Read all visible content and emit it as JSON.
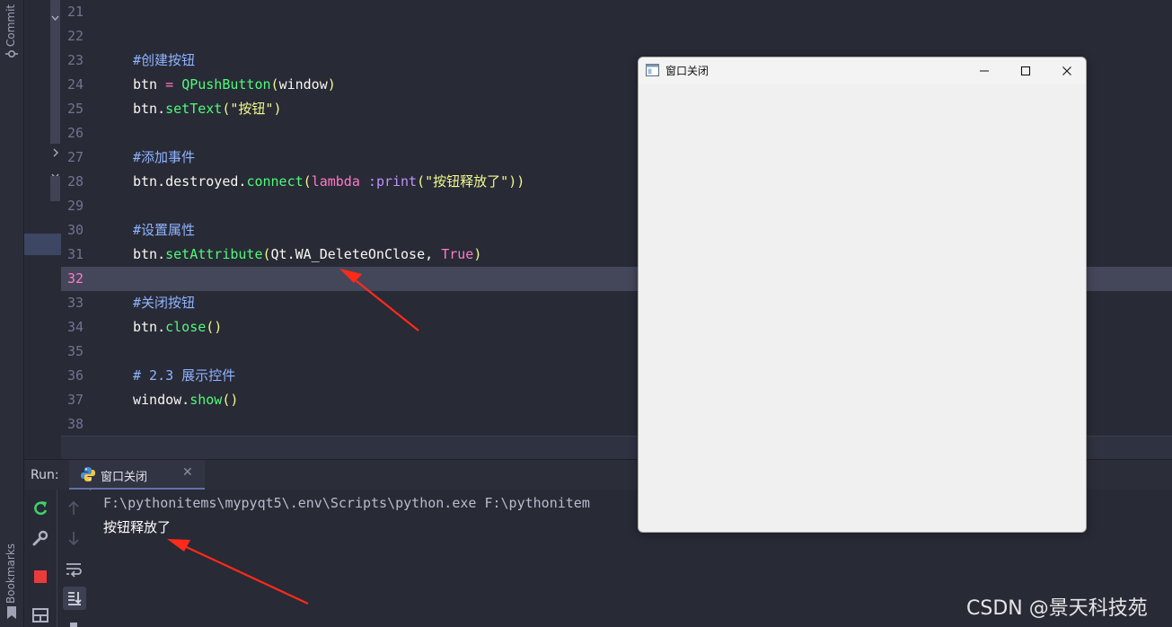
{
  "side_tool_windows": {
    "commit_label": "Commit",
    "bookmarks_label": "Bookmarks"
  },
  "editor": {
    "current_line": "32",
    "lines": [
      {
        "num": "21",
        "tokens": []
      },
      {
        "num": "22",
        "tokens": []
      },
      {
        "num": "23",
        "tokens": [
          {
            "t": "#创建按钮",
            "c": "cmt"
          }
        ]
      },
      {
        "num": "24",
        "tokens": [
          {
            "t": "btn ",
            "c": "var"
          },
          {
            "t": "=",
            "c": "op"
          },
          {
            "t": " ",
            "c": "var"
          },
          {
            "t": "QPushButton",
            "c": "fn"
          },
          {
            "t": "(",
            "c": "par"
          },
          {
            "t": "window",
            "c": "var"
          },
          {
            "t": ")",
            "c": "par"
          }
        ]
      },
      {
        "num": "25",
        "tokens": [
          {
            "t": "btn.",
            "c": "var"
          },
          {
            "t": "setText",
            "c": "fn"
          },
          {
            "t": "(",
            "c": "par"
          },
          {
            "t": "\"按钮\"",
            "c": "str"
          },
          {
            "t": ")",
            "c": "par"
          }
        ]
      },
      {
        "num": "26",
        "tokens": []
      },
      {
        "num": "27",
        "tokens": [
          {
            "t": "#添加事件",
            "c": "cmt"
          }
        ]
      },
      {
        "num": "28",
        "tokens": [
          {
            "t": "btn.destroyed.",
            "c": "var"
          },
          {
            "t": "connect",
            "c": "fn"
          },
          {
            "t": "(",
            "c": "par"
          },
          {
            "t": "lambda",
            "c": "kw"
          },
          {
            "t": " :",
            "c": "kwa"
          },
          {
            "t": "print",
            "c": "kwa"
          },
          {
            "t": "(",
            "c": "par"
          },
          {
            "t": "\"按钮释放了\"",
            "c": "str"
          },
          {
            "t": "))",
            "c": "par"
          }
        ]
      },
      {
        "num": "29",
        "tokens": []
      },
      {
        "num": "30",
        "tokens": [
          {
            "t": "#设置属性",
            "c": "cmt"
          }
        ]
      },
      {
        "num": "31",
        "tokens": [
          {
            "t": "btn.",
            "c": "var"
          },
          {
            "t": "setAttribute",
            "c": "fn"
          },
          {
            "t": "(",
            "c": "par"
          },
          {
            "t": "Qt.WA_DeleteOnClose, ",
            "c": "var"
          },
          {
            "t": "True",
            "c": "kw"
          },
          {
            "t": ")",
            "c": "par"
          }
        ]
      },
      {
        "num": "32",
        "tokens": []
      },
      {
        "num": "33",
        "tokens": [
          {
            "t": "#关闭按钮",
            "c": "cmt"
          }
        ]
      },
      {
        "num": "34",
        "tokens": [
          {
            "t": "btn.",
            "c": "var"
          },
          {
            "t": "close",
            "c": "fn"
          },
          {
            "t": "()",
            "c": "par"
          }
        ]
      },
      {
        "num": "35",
        "tokens": []
      },
      {
        "num": "36",
        "tokens": [
          {
            "t": "# 2.3 展示控件",
            "c": "cmt"
          }
        ]
      },
      {
        "num": "37",
        "tokens": [
          {
            "t": "window.",
            "c": "var"
          },
          {
            "t": "show",
            "c": "fn"
          },
          {
            "t": "()",
            "c": "par"
          }
        ]
      },
      {
        "num": "38",
        "tokens": []
      }
    ]
  },
  "run_panel": {
    "label": "Run:",
    "tab": {
      "label": "窗口关闭",
      "icon": "python-icon",
      "close_glyph": "✕"
    },
    "output": [
      {
        "text": "F:\\pythonitems\\mypyqt5\\.env\\Scripts\\python.exe F:\\pythonitem",
        "color": "#b9bccb"
      },
      {
        "text": "按钮释放了",
        "color": "#ffffff"
      }
    ],
    "tools_left": [
      "rerun-icon",
      "wrench-icon",
      "stop-icon",
      "layout-icon"
    ],
    "tools_right": [
      "up-arrow-icon",
      "down-arrow-icon",
      "soft-wrap-icon",
      "scroll-to-end-icon",
      "print-icon"
    ]
  },
  "qt_window": {
    "title": "窗口关闭",
    "controls": [
      "minimize-icon",
      "maximize-icon",
      "close-icon"
    ]
  },
  "watermark": "CSDN @景天科技苑",
  "colors": {
    "editor_bg": "#282a36",
    "caret_line": "#44475a",
    "comment": "#8fb4ff",
    "function": "#50fa7b",
    "string": "#f1fa8c",
    "keyword": "#ff79c6",
    "annotation_arrow": "#ff2a1a"
  }
}
